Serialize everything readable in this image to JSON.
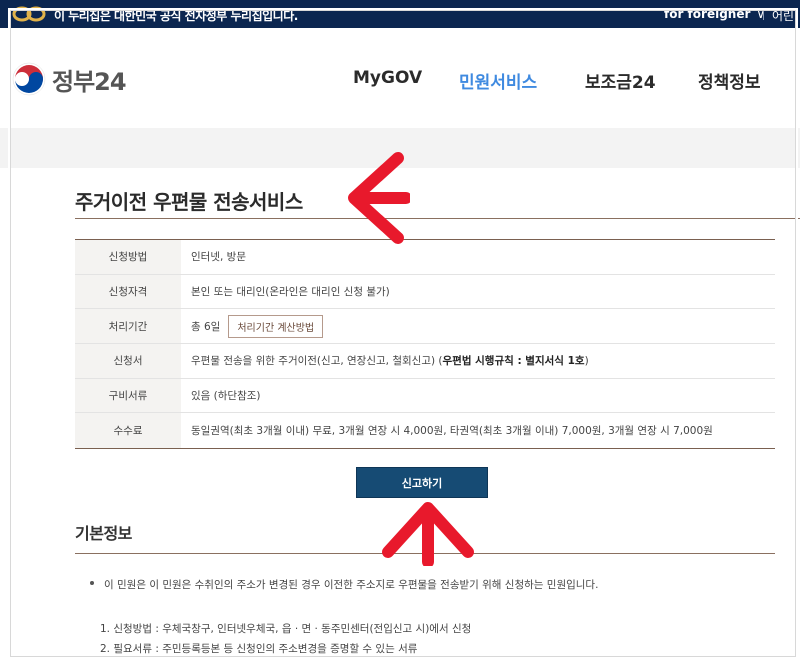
{
  "topbar": {
    "gov_notice": "이 누리집은 대한민국 공식 전자정부 누리집입니다.",
    "foreigner_label": "for foreigner",
    "lang_label": "어린"
  },
  "header": {
    "logo_text": "정부24",
    "nav": [
      {
        "label": "MyGOV",
        "active": false
      },
      {
        "label": "민원서비스",
        "active": true
      },
      {
        "label": "보조금24",
        "active": false
      },
      {
        "label": "정책정보",
        "active": false
      }
    ]
  },
  "page": {
    "title": "주거이전 우편물 전송서비스"
  },
  "info": {
    "rows": [
      {
        "label": "신청방법",
        "value": "인터넷, 방문"
      },
      {
        "label": "신청자격",
        "value": "본인 또는 대리인(온라인은 대리인 신청 불가)"
      },
      {
        "label": "처리기간",
        "value": "총 6일",
        "button": "처리기간 계산방법"
      },
      {
        "label": "신청서",
        "value": "우편물 전송을 위한 주거이전(신고, 연장신고, 철회신고) (",
        "bold": "우편법 시행규칙 : 별지서식 1호",
        "suffix": ")"
      },
      {
        "label": "구비서류",
        "value": "있음 (하단참조)"
      },
      {
        "label": "수수료",
        "value": "동일권역(최초 3개월 이내) 무료, 3개월 연장 시 4,000원, 타권역(최초 3개월 이내) 7,000원, 3개월 연장 시 7,000원"
      }
    ]
  },
  "apply_button": "신고하기",
  "basic_info": {
    "title": "기본정보",
    "bullet": "이 민원은 이 민원은 수취인의 주소가 변경된 경우 이전한 주소지로 우편물을 전송받기 위해 신청하는 민원입니다.",
    "items": [
      "1. 신청방법 : 우체국창구, 인터넷우체국, 읍 · 면 · 동주민센터(전입신고 시)에서 신청",
      "2. 필요서류 : 주민등록등본 등 신청인의 주소변경을 증명할 수 있는 서류"
    ]
  },
  "colors": {
    "topbar_bg": "#0b2650",
    "nav_active": "#3f8ae0",
    "apply_bg": "#164b74",
    "annotation_arrow": "#e8192c"
  }
}
